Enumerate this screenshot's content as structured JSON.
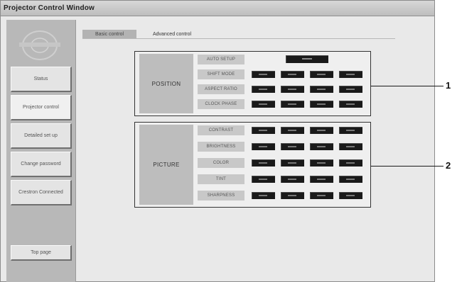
{
  "window": {
    "title": "Projector Control Window"
  },
  "sidebar": {
    "items": [
      {
        "label": "Status"
      },
      {
        "label": "Projector control"
      },
      {
        "label": "Detailed set up"
      },
      {
        "label": "Change password"
      },
      {
        "label": "Crestron Connected"
      },
      {
        "label": "Top page"
      }
    ]
  },
  "tabs": {
    "basic": "Basic control",
    "advanced": "Advanced control"
  },
  "groups": [
    {
      "title": "POSITION",
      "rows": [
        {
          "label": "AUTO SETUP",
          "buttons": 1
        },
        {
          "label": "SHIFT MODE",
          "buttons": 4
        },
        {
          "label": "ASPECT RATIO",
          "buttons": 4
        },
        {
          "label": "CLOCK PHASE",
          "buttons": 4
        }
      ]
    },
    {
      "title": "PICTURE",
      "rows": [
        {
          "label": "CONTRAST",
          "buttons": 4
        },
        {
          "label": "BRIGHTNESS",
          "buttons": 4
        },
        {
          "label": "COLOR",
          "buttons": 4
        },
        {
          "label": "TINT",
          "buttons": 4
        },
        {
          "label": "SHARPNESS",
          "buttons": 4
        }
      ]
    }
  ],
  "callouts": [
    "1",
    "2"
  ]
}
